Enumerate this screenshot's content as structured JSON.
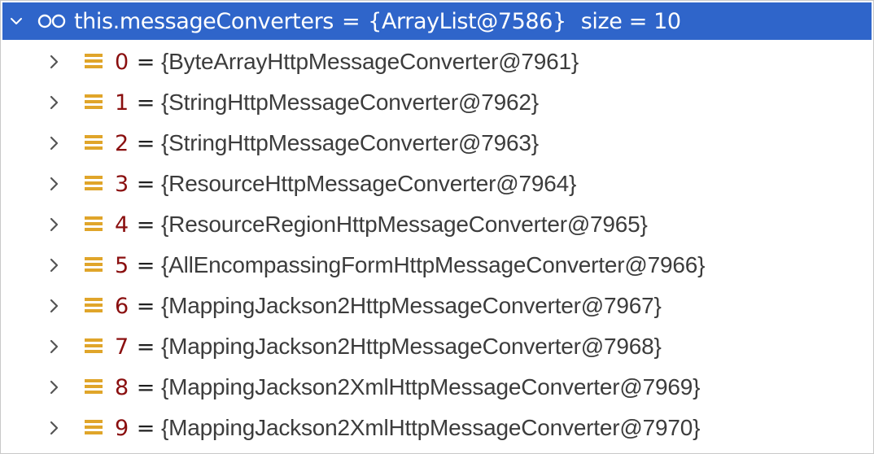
{
  "root": {
    "name": "this.messageConverters",
    "equals": "=",
    "value": "{ArrayList@7586}",
    "size_text": "size = 10",
    "expanded": true,
    "icon": "watch-icon",
    "colors": {
      "selection_bg": "#2f65ca",
      "selection_fg": "#ffffff"
    }
  },
  "children": [
    {
      "index": "0",
      "equals": "=",
      "value": "{ByteArrayHttpMessageConverter@7961}"
    },
    {
      "index": "1",
      "equals": "=",
      "value": "{StringHttpMessageConverter@7962}"
    },
    {
      "index": "2",
      "equals": "=",
      "value": "{StringHttpMessageConverter@7963}"
    },
    {
      "index": "3",
      "equals": "=",
      "value": "{ResourceHttpMessageConverter@7964}"
    },
    {
      "index": "4",
      "equals": "=",
      "value": "{ResourceRegionHttpMessageConverter@7965}"
    },
    {
      "index": "5",
      "equals": "=",
      "value": "{AllEncompassingFormHttpMessageConverter@7966}"
    },
    {
      "index": "6",
      "equals": "=",
      "value": "{MappingJackson2HttpMessageConverter@7967}"
    },
    {
      "index": "7",
      "equals": "=",
      "value": "{MappingJackson2HttpMessageConverter@7968}"
    },
    {
      "index": "8",
      "equals": "=",
      "value": "{MappingJackson2XmlHttpMessageConverter@7969}"
    },
    {
      "index": "9",
      "equals": "=",
      "value": "{MappingJackson2XmlHttpMessageConverter@7970}"
    }
  ],
  "icons": {
    "expand": "chevron-right-icon",
    "collapse": "chevron-down-icon",
    "field": "field-icon"
  },
  "colors": {
    "index": "#8a0f0f",
    "value": "#3c3c3c",
    "field_icon": "#e0a52a",
    "chevron": "#555555"
  }
}
